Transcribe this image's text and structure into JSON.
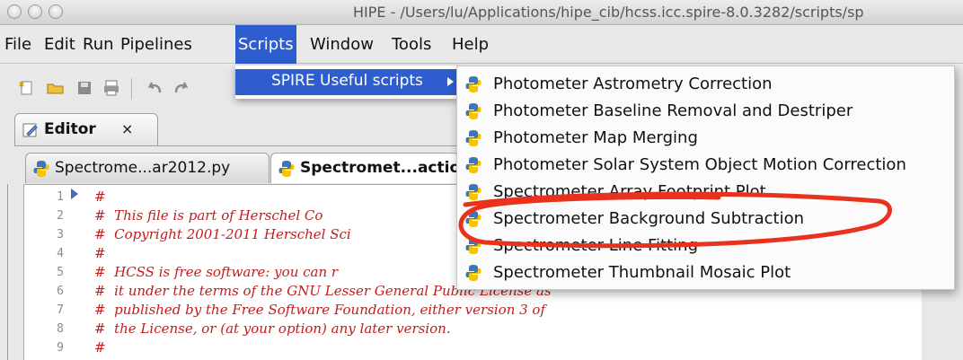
{
  "window": {
    "title": "HIPE - /Users/lu/Applications/hipe_cib/hcss.icc.spire-8.0.3282/scripts/sp"
  },
  "menubar": {
    "items": [
      {
        "label": "File"
      },
      {
        "label": "Edit"
      },
      {
        "label": "Run"
      },
      {
        "label": "Pipelines"
      },
      {
        "label": "Scripts"
      },
      {
        "label": "Window"
      },
      {
        "label": "Tools"
      },
      {
        "label": "Help"
      }
    ],
    "active": "Scripts"
  },
  "toolbar": {
    "icons": [
      "new-file-icon",
      "open-folder-icon",
      "save-icon",
      "print-icon",
      "undo-icon",
      "redo-icon"
    ]
  },
  "panel": {
    "tab_label": "Editor",
    "close_glyph": "×"
  },
  "file_tabs": [
    {
      "label": "Spectrome...ar2012.py",
      "active": false
    },
    {
      "label": "Spectromet...actio",
      "active": true
    }
  ],
  "scripts_menu": {
    "items": [
      {
        "label": "SPIRE Useful scripts"
      }
    ]
  },
  "submenu": {
    "items": [
      {
        "label": "Photometer Astrometry Correction"
      },
      {
        "label": "Photometer Baseline Removal and Destriper"
      },
      {
        "label": "Photometer Map Merging"
      },
      {
        "label": "Photometer Solar System Object Motion Correction"
      },
      {
        "label": "Spectrometer Array Footprint Plot"
      },
      {
        "label": "Spectrometer Background Subtraction"
      },
      {
        "label": "Spectrometer Line Fitting"
      },
      {
        "label": "Spectrometer Thumbnail Mosaic Plot"
      }
    ],
    "highlighted": "Spectrometer Background Subtraction"
  },
  "editor": {
    "lines": [
      {
        "n": "1",
        "text": "#"
      },
      {
        "n": "2",
        "text": "#  This file is part of Herschel Co"
      },
      {
        "n": "3",
        "text": "#  Copyright 2001-2011 Herschel Sci"
      },
      {
        "n": "4",
        "text": "#"
      },
      {
        "n": "5",
        "text": "#  HCSS is free software: you can r"
      },
      {
        "n": "6",
        "text": "#  it under the terms of the GNU Lesser General Public License as"
      },
      {
        "n": "7",
        "text": "#  published by the Free Software Foundation, either version 3 of"
      },
      {
        "n": "8",
        "text": "#  the License, or (at your option) any later version."
      },
      {
        "n": "9",
        "text": "#"
      }
    ]
  },
  "colors": {
    "menu_highlight": "#2d5dce",
    "comment_text": "#c21d1d",
    "annotation": "#e8321e"
  }
}
